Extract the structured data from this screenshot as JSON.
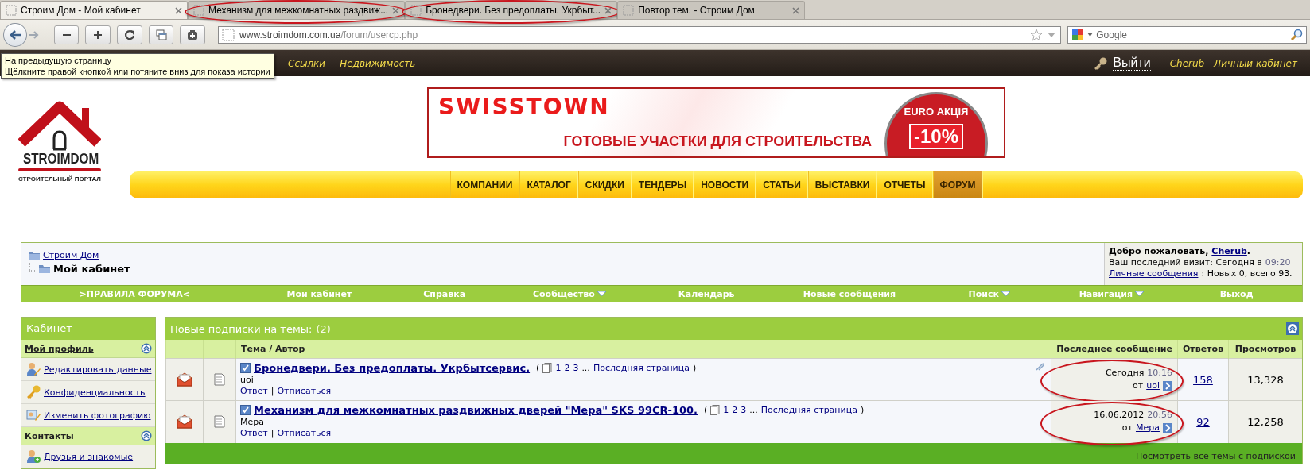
{
  "browser": {
    "tabs": [
      {
        "title": "Строим Дом - Мой кабинет",
        "selected": true,
        "circled": false
      },
      {
        "title": "Механизм для межкомнатных раздвиж...",
        "selected": false,
        "circled": true
      },
      {
        "title": "Бронедвери. Без предоплаты. Укрбыт...",
        "selected": false,
        "circled": true
      },
      {
        "title": "Повтор тем. - Строим Дом",
        "selected": false,
        "circled": false
      }
    ],
    "address": {
      "domain": "www.stroimdom.com.ua",
      "path": "/forum/usercp.php"
    },
    "search": {
      "placeholder": "Google"
    },
    "tooltip": {
      "lines": [
        "На предыдущую страницу",
        "Щёлкните правой кнопкой или потяните вниз для показа истории"
      ]
    }
  },
  "site_bar": {
    "links": [
      "Ссылки",
      "Недвижимость"
    ],
    "logout": "Выйти",
    "account": "Cherub - Личный кабинет"
  },
  "header": {
    "logo": {
      "name": "STROIMDOM",
      "tagline": "СТРОИТЕЛЬНЫЙ ПОРТАЛ"
    },
    "banner": {
      "brand": "SWISSTOWN",
      "headline": "ГОТОВЫЕ УЧАСТКИ ДЛЯ СТРОИТЕЛЬСТВА",
      "badge_title": "EURO АКЦІЯ",
      "badge_discount": "-10%"
    },
    "menu": [
      {
        "label": "КОМПАНИИ",
        "selected": false
      },
      {
        "label": "КАТАЛОГ",
        "selected": false
      },
      {
        "label": "СКИДКИ",
        "selected": false
      },
      {
        "label": "ТЕНДЕРЫ",
        "selected": false
      },
      {
        "label": "НОВОСТИ",
        "selected": false
      },
      {
        "label": "СТАТЬИ",
        "selected": false
      },
      {
        "label": "ВЫСТАВКИ",
        "selected": false
      },
      {
        "label": "ОТЧЕТЫ",
        "selected": false
      },
      {
        "label": "ФОРУМ",
        "selected": true
      }
    ]
  },
  "forum_nav": {
    "breadcrumb": {
      "root": "Строим Дом",
      "current": "Мой кабинет"
    },
    "welcome": {
      "greeting": "Добро пожаловать,",
      "user": "Cherub",
      "greeting_end": ".",
      "last_visit": "Ваш последний визит: Сегодня в",
      "last_visit_time": "09:20",
      "messages_link": "Личные сообщения",
      "messages_info": ": Новых 0, всего 93."
    },
    "links": [
      {
        "label": ">ПРАВИЛА ФОРУМА<",
        "dropdown": false
      },
      {
        "label": "Мой кабинет",
        "dropdown": false
      },
      {
        "label": "Справка",
        "dropdown": false
      },
      {
        "label": "Сообщество",
        "dropdown": true
      },
      {
        "label": "Календарь",
        "dropdown": false
      },
      {
        "label": "Новые сообщения",
        "dropdown": false
      },
      {
        "label": "Поиск",
        "dropdown": true
      },
      {
        "label": "Навигация",
        "dropdown": true
      },
      {
        "label": "Выход",
        "dropdown": false
      }
    ]
  },
  "sidebar": {
    "title": "Кабинет",
    "sections": [
      {
        "title": "Мой профиль",
        "link": true,
        "items": [
          {
            "label": "Редактировать данные",
            "kind": "edit"
          },
          {
            "label": "Конфиденциальность",
            "kind": "key"
          },
          {
            "label": "Изменить фотографию",
            "kind": "photo"
          }
        ]
      },
      {
        "title": "Контакты",
        "link": false,
        "items": [
          {
            "label": "Друзья и знакомые",
            "kind": "friends"
          }
        ]
      }
    ]
  },
  "subscriptions": {
    "title": "Новые подписки на темы:",
    "count": "(2)",
    "columns": [
      "Тема / Автор",
      "Последнее сообщение",
      "Ответов",
      "Просмотров"
    ],
    "threads": [
      {
        "title": "Бронедвери. Без предоплаты. Укрбытсервис.",
        "open": "(",
        "pages": [
          "1",
          "2",
          "3"
        ],
        "ellipsis": "...",
        "last_page": "Последняя страница",
        "close": ")",
        "author": "uoi",
        "actions": [
          "Ответ",
          "Отписаться"
        ],
        "separator": "|",
        "attachment": true,
        "last_date": "Сегодня",
        "last_time": "10:16",
        "by": "от",
        "last_user": "uoi",
        "circled": true,
        "replies": "158",
        "views": "13,328"
      },
      {
        "title": "Механизм для межкомнатных раздвижных дверей \"Мера\" SKS 99CR-100.",
        "open": "(",
        "pages": [
          "1",
          "2",
          "3"
        ],
        "ellipsis": "...",
        "last_page": "Последняя страница",
        "close": ")",
        "author": "Мера",
        "actions": [
          "Ответ",
          "Отписаться"
        ],
        "separator": "|",
        "attachment": false,
        "last_date": "16.06.2012",
        "last_time": "20:56",
        "by": "от",
        "last_user": "Мера",
        "circled": true,
        "replies": "92",
        "views": "12,258"
      }
    ],
    "footer_link": "Посмотреть все темы с подпиской"
  }
}
